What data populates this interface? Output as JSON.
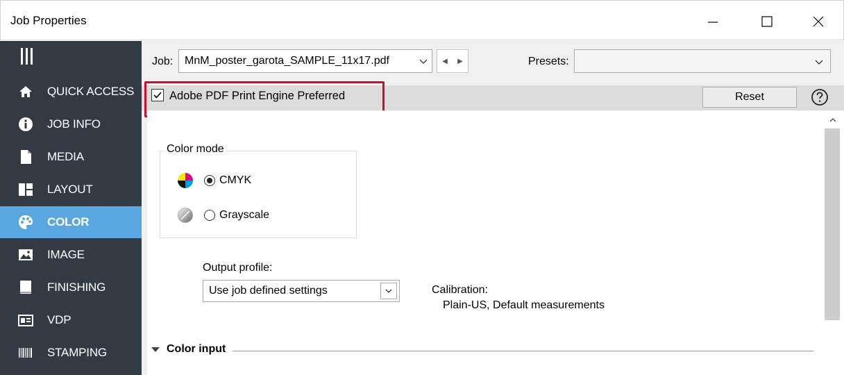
{
  "window": {
    "title": "Job Properties"
  },
  "sidebar": {
    "items": [
      {
        "label": "QUICK ACCESS",
        "icon": "home-icon",
        "active": false
      },
      {
        "label": "JOB INFO",
        "icon": "info-icon",
        "active": false
      },
      {
        "label": "MEDIA",
        "icon": "document-icon",
        "active": false
      },
      {
        "label": "LAYOUT",
        "icon": "layout-icon",
        "active": false
      },
      {
        "label": "COLOR",
        "icon": "palette-icon",
        "active": true
      },
      {
        "label": "IMAGE",
        "icon": "image-icon",
        "active": false
      },
      {
        "label": "FINISHING",
        "icon": "book-icon",
        "active": false
      },
      {
        "label": "VDP",
        "icon": "vdp-icon",
        "active": false
      },
      {
        "label": "STAMPING",
        "icon": "barcode-icon",
        "active": false
      }
    ]
  },
  "jobbar": {
    "job_label": "Job:",
    "job_value": "MnM_poster_garota_SAMPLE_11x17.pdf",
    "presets_label": "Presets:",
    "presets_value": ""
  },
  "engine": {
    "checkbox_label": "Adobe PDF Print Engine Preferred",
    "checked": true,
    "reset_label": "Reset"
  },
  "color_mode": {
    "legend": "Color mode",
    "options": [
      {
        "label": "CMYK",
        "selected": true
      },
      {
        "label": "Grayscale",
        "selected": false
      }
    ]
  },
  "output": {
    "label": "Output profile:",
    "value": "Use job defined settings"
  },
  "calibration": {
    "label": "Calibration:",
    "value": "Plain-US, Default measurements"
  },
  "sections": {
    "color_input": "Color input"
  },
  "colors": {
    "sidebar_bg": "#323b44",
    "active_bg": "#5aa6e0",
    "highlight": "#c8102e"
  }
}
